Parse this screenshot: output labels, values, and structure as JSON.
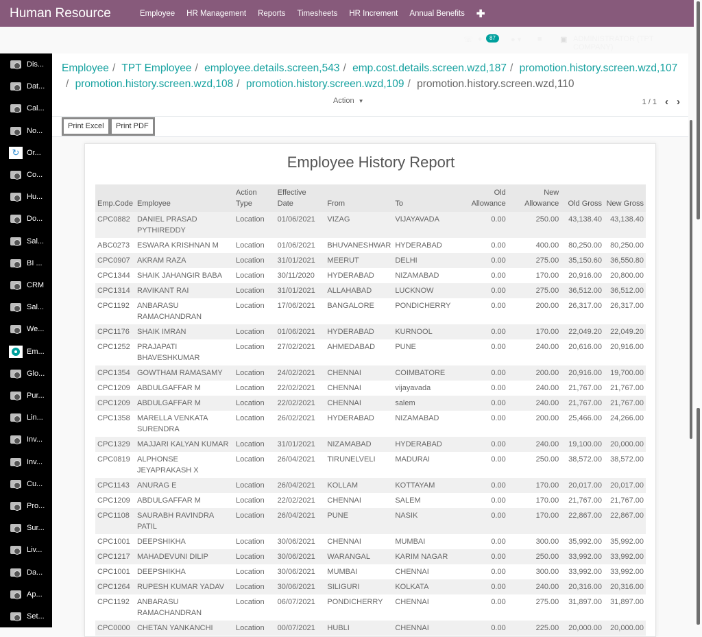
{
  "app": {
    "title": "Human Resource",
    "menu": [
      "Employee",
      "HR Management",
      "Reports",
      "Timesheets",
      "HR Increment",
      "Annual Benefits"
    ],
    "add_menu_icon": "plus-icon"
  },
  "systray": {
    "messages_count": "87",
    "user": "ADMINISTRATOR (TPT COMPANY)"
  },
  "sidebar": {
    "items": [
      {
        "label": "Dis...",
        "icon": "camera-icon"
      },
      {
        "label": "Dat...",
        "icon": "camera-icon"
      },
      {
        "label": "Cal...",
        "icon": "camera-icon"
      },
      {
        "label": "No...",
        "icon": "camera-icon"
      },
      {
        "label": "Or...",
        "icon": "handshake-icon"
      },
      {
        "label": "Co...",
        "icon": "camera-icon"
      },
      {
        "label": "Hu...",
        "icon": "camera-icon"
      },
      {
        "label": "Do...",
        "icon": "camera-icon"
      },
      {
        "label": "Sal...",
        "icon": "camera-icon"
      },
      {
        "label": "BI ...",
        "icon": "camera-icon"
      },
      {
        "label": "CRM",
        "icon": "camera-icon"
      },
      {
        "label": "Sal...",
        "icon": "camera-icon"
      },
      {
        "label": "We...",
        "icon": "camera-icon"
      },
      {
        "label": "Em...",
        "icon": "map-pin-icon"
      },
      {
        "label": "Glo...",
        "icon": "camera-icon"
      },
      {
        "label": "Pur...",
        "icon": "camera-icon"
      },
      {
        "label": "Lin...",
        "icon": "camera-icon"
      },
      {
        "label": "Inv...",
        "icon": "camera-icon"
      },
      {
        "label": "Inv...",
        "icon": "camera-icon"
      },
      {
        "label": "Cu...",
        "icon": "camera-icon"
      },
      {
        "label": "Pro...",
        "icon": "camera-icon"
      },
      {
        "label": "Sur...",
        "icon": "camera-icon"
      },
      {
        "label": "Liv...",
        "icon": "camera-icon"
      },
      {
        "label": "Da...",
        "icon": "camera-icon"
      },
      {
        "label": "Ap...",
        "icon": "camera-icon"
      },
      {
        "label": "Set...",
        "icon": "camera-icon"
      }
    ]
  },
  "breadcrumb": {
    "links": [
      "Employee",
      "TPT Employee",
      "employee.details.screen,543",
      "emp.cost.details.screen.wzd,187",
      "promotion.history.screen.wzd,107",
      "promotion.history.screen.wzd,108",
      "promotion.history.screen.wzd,109"
    ],
    "current": "promotion.history.screen.wzd,110",
    "separator": "/"
  },
  "controls": {
    "action_label": "Action",
    "pager": "1 / 1"
  },
  "buttons": {
    "print_excel": "Print Excel",
    "print_pdf": "Print PDF"
  },
  "report": {
    "title": "Employee History Report",
    "columns": [
      [
        "",
        "Emp.Code"
      ],
      [
        "",
        "Employee"
      ],
      [
        "Action",
        "Type"
      ],
      [
        "Effective",
        "Date"
      ],
      [
        "",
        "From"
      ],
      [
        "",
        "To"
      ],
      [
        "Old",
        "Allowance"
      ],
      [
        "New",
        "Allowance"
      ],
      [
        "",
        "Old Gross"
      ],
      [
        "",
        "New Gross"
      ]
    ],
    "rows": [
      [
        "CPC0882",
        "DANIEL PRASAD PYTHIREDDY",
        "Location",
        "01/06/2021",
        "VIZAG",
        "VIJAYAVADA",
        "0.00",
        "250.00",
        "43,138.40",
        "43,138.40"
      ],
      [
        "ABC0273",
        "ESWARA KRISHNAN M",
        "Location",
        "01/06/2021",
        "BHUVANESHWAR",
        "HYDERABAD",
        "0.00",
        "400.00",
        "80,250.00",
        "80,250.00"
      ],
      [
        "CPC0907",
        "AKRAM RAZA",
        "Location",
        "31/01/2021",
        "MEERUT",
        "DELHI",
        "0.00",
        "275.00",
        "35,150.60",
        "36,550.80"
      ],
      [
        "CPC1344",
        "SHAIK JAHANGIR BABA",
        "Location",
        "30/11/2020",
        "HYDERABAD",
        "NIZAMABAD",
        "0.00",
        "170.00",
        "20,916.00",
        "20,800.00"
      ],
      [
        "CPC1314",
        "RAVIKANT RAI",
        "Location",
        "31/01/2021",
        "ALLAHABAD",
        "LUCKNOW",
        "0.00",
        "275.00",
        "36,512.00",
        "36,512.00"
      ],
      [
        "CPC1192",
        "ANBARASU RAMACHANDRAN",
        "Location",
        "17/06/2021",
        "BANGALORE",
        "PONDICHERRY",
        "0.00",
        "200.00",
        "26,317.00",
        "26,317.00"
      ],
      [
        "CPC1176",
        "SHAIK IMRAN",
        "Location",
        "01/06/2021",
        "HYDERABAD",
        "KURNOOL",
        "0.00",
        "170.00",
        "22,049.20",
        "22,049.20"
      ],
      [
        "CPC1252",
        "PRAJAPATI BHAVESHKUMAR",
        "Location",
        "27/02/2021",
        "AHMEDABAD",
        "PUNE",
        "0.00",
        "240.00",
        "20,616.00",
        "20,916.00"
      ],
      [
        "CPC1354",
        "GOWTHAM RAMASAMY",
        "Location",
        "24/02/2021",
        "CHENNAI",
        "COIMBATORE",
        "0.00",
        "200.00",
        "20,916.00",
        "19,700.00"
      ],
      [
        "CPC1209",
        "ABDULGAFFAR M",
        "Location",
        "22/02/2021",
        "CHENNAI",
        "vijayavada",
        "0.00",
        "240.00",
        "21,767.00",
        "21,767.00"
      ],
      [
        "CPC1209",
        "ABDULGAFFAR M",
        "Location",
        "22/02/2021",
        "CHENNAI",
        "salem",
        "0.00",
        "240.00",
        "21,767.00",
        "21,767.00"
      ],
      [
        "CPC1358",
        "MARELLA VENKATA SURENDRA",
        "Location",
        "26/02/2021",
        "HYDERABAD",
        "NIZAMABAD",
        "0.00",
        "200.00",
        "25,466.00",
        "24,266.00"
      ],
      [
        "CPC1329",
        "MAJJARI KALYAN KUMAR",
        "Location",
        "31/01/2021",
        "NIZAMABAD",
        "HYDERABAD",
        "0.00",
        "240.00",
        "19,100.00",
        "20,000.00"
      ],
      [
        "CPC0819",
        "ALPHONSE JEYAPRAKASH X",
        "Location",
        "26/04/2021",
        "TIRUNELVELI",
        "MADURAI",
        "0.00",
        "250.00",
        "38,572.00",
        "38,572.00"
      ],
      [
        "CPC1143",
        "ANURAG E",
        "Location",
        "26/04/2021",
        "KOLLAM",
        "KOTTAYAM",
        "0.00",
        "170.00",
        "20,017.00",
        "20,017.00"
      ],
      [
        "CPC1209",
        "ABDULGAFFAR M",
        "Location",
        "22/02/2021",
        "CHENNAI",
        "SALEM",
        "0.00",
        "170.00",
        "21,767.00",
        "21,767.00"
      ],
      [
        "CPC1108",
        "SAURABH RAVINDRA PATIL",
        "Location",
        "26/04/2021",
        "PUNE",
        "NASIK",
        "0.00",
        "170.00",
        "22,867.00",
        "22,867.00"
      ],
      [
        "CPC1001",
        "DEEPSHIKHA",
        "Location",
        "30/06/2021",
        "CHENNAI",
        "MUMBAI",
        "0.00",
        "300.00",
        "35,992.00",
        "35,992.00"
      ],
      [
        "CPC1217",
        "MAHADEVUNI DILIP",
        "Location",
        "30/06/2021",
        "WARANGAL",
        "KARIM NAGAR",
        "0.00",
        "250.00",
        "33,992.00",
        "33,992.00"
      ],
      [
        "CPC1001",
        "DEEPSHIKHA",
        "Location",
        "30/06/2021",
        "MUMBAI",
        "CHENNAI",
        "0.00",
        "300.00",
        "33,992.00",
        "33,992.00"
      ],
      [
        "CPC1264",
        "RUPESH KUMAR YADAV",
        "Location",
        "30/06/2021",
        "SILIGURI",
        "KOLKATA",
        "0.00",
        "240.00",
        "20,316.00",
        "20,316.00"
      ],
      [
        "CPC1192",
        "ANBARASU RAMACHANDRAN",
        "Location",
        "06/07/2021",
        "PONDICHERRY",
        "CHENNAI",
        "0.00",
        "275.00",
        "31,897.00",
        "31,897.00"
      ],
      [
        "CPC0000",
        "CHETAN YANKANCHI",
        "Location",
        "00/07/2021",
        "HUBLI",
        "CHENNAI",
        "0.00",
        "225.00",
        "20,000.00",
        "20,000.00"
      ]
    ]
  }
}
